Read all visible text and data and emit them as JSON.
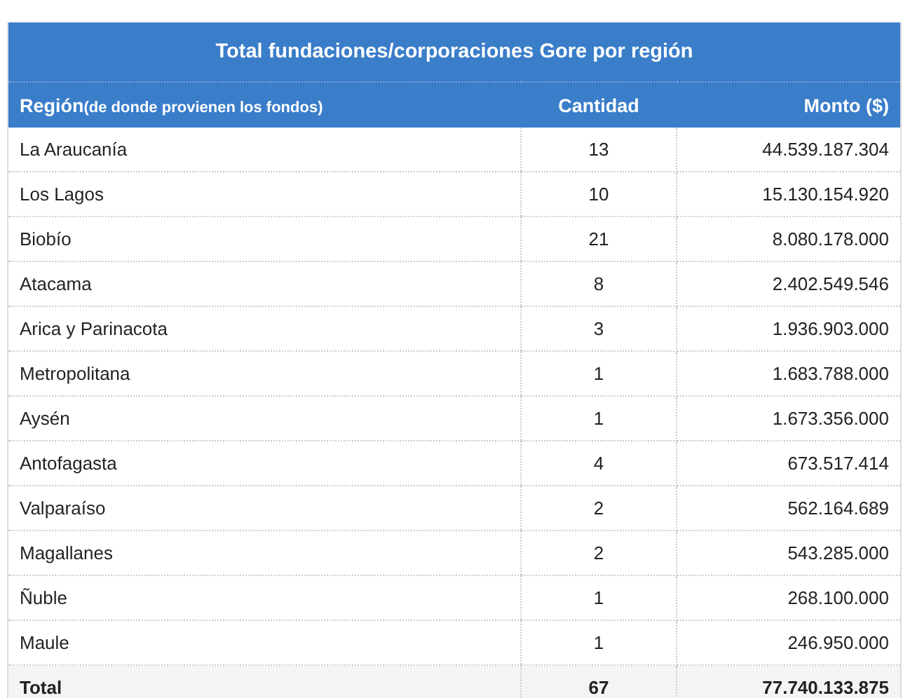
{
  "table": {
    "title": "Total fundaciones/corporaciones Gore por región",
    "columns": [
      {
        "label": "Región",
        "note": "(de donde provienen los fondos)"
      },
      {
        "label": "Cantidad"
      },
      {
        "label": "Monto ($)"
      }
    ],
    "rows": [
      {
        "region": "La Araucanía",
        "cantidad": "13",
        "monto": "44.539.187.304"
      },
      {
        "region": "Los Lagos",
        "cantidad": "10",
        "monto": "15.130.154.920"
      },
      {
        "region": "Biobío",
        "cantidad": "21",
        "monto": "8.080.178.000"
      },
      {
        "region": "Atacama",
        "cantidad": "8",
        "monto": "2.402.549.546"
      },
      {
        "region": "Arica y Parinacota",
        "cantidad": "3",
        "monto": "1.936.903.000"
      },
      {
        "region": "Metropolitana",
        "cantidad": "1",
        "monto": "1.683.788.000"
      },
      {
        "region": "Aysén",
        "cantidad": "1",
        "monto": "1.673.356.000"
      },
      {
        "region": "Antofagasta",
        "cantidad": "4",
        "monto": "673.517.414"
      },
      {
        "region": "Valparaíso",
        "cantidad": "2",
        "monto": "562.164.689"
      },
      {
        "region": "Magallanes",
        "cantidad": "2",
        "monto": "543.285.000"
      },
      {
        "region": "Ñuble",
        "cantidad": "1",
        "monto": "268.100.000"
      },
      {
        "region": "Maule",
        "cantidad": "1",
        "monto": "246.950.000"
      }
    ],
    "total": {
      "region": "Total",
      "cantidad": "67",
      "monto": "77.740.133.875"
    }
  }
}
